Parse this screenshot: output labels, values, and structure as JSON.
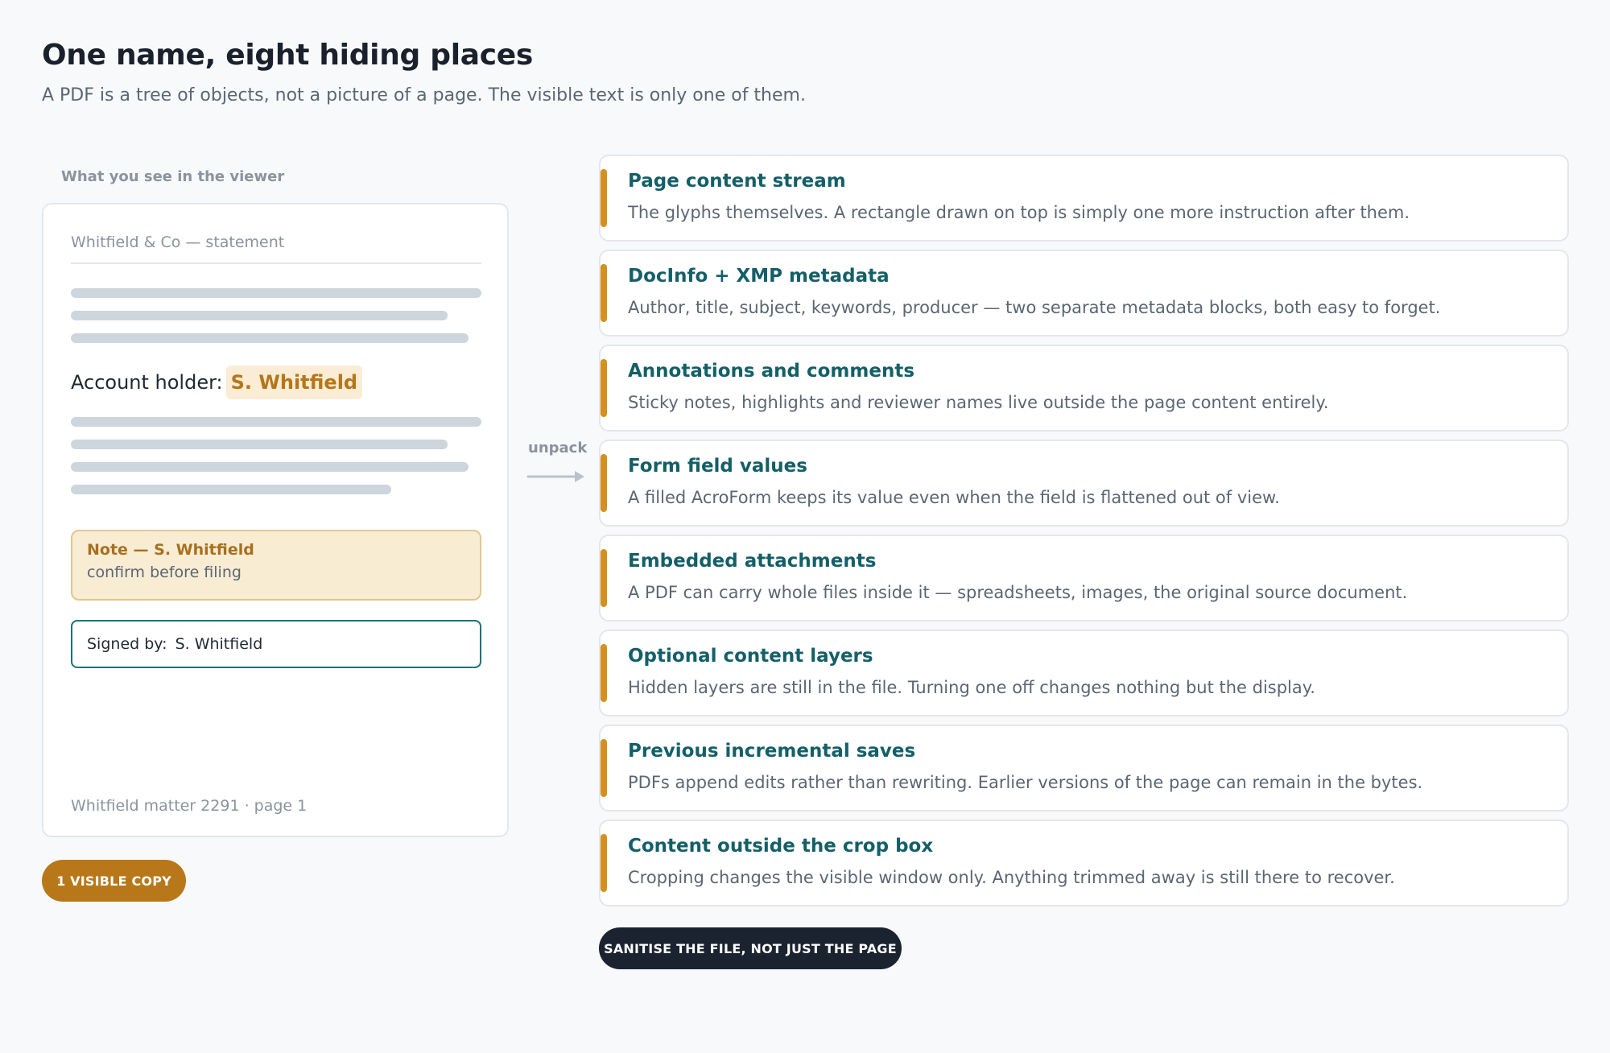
{
  "header": {
    "title": "One name, eight hiding places",
    "subtitle": "A PDF is a tree of objects, not a picture of a page. The visible text is only one of them."
  },
  "viewer": {
    "label": "What you see in the viewer",
    "doc_header": "Whitfield & Co — statement",
    "holder_label": "Account holder:",
    "holder_name": "S. Whitfield",
    "note_title": "Note — S. Whitfield",
    "note_body": "confirm before filing",
    "signed_label": "Signed by:",
    "signed_name": "S. Whitfield",
    "footer": "Whitfield matter 2291 · page 1",
    "badge": "1 VISIBLE COPY"
  },
  "connector": {
    "label": "unpack"
  },
  "places": [
    {
      "title": "Page content stream",
      "desc": "The glyphs themselves. A rectangle drawn on top is simply one more instruction after them."
    },
    {
      "title": "DocInfo + XMP metadata",
      "desc": "Author, title, subject, keywords, producer — two separate metadata blocks, both easy to forget."
    },
    {
      "title": "Annotations and comments",
      "desc": "Sticky notes, highlights and reviewer names live outside the page content entirely."
    },
    {
      "title": "Form field values",
      "desc": "A filled AcroForm keeps its value even when the field is flattened out of view."
    },
    {
      "title": "Embedded attachments",
      "desc": "A PDF can carry whole files inside it — spreadsheets, images, the original source document."
    },
    {
      "title": "Optional content layers",
      "desc": "Hidden layers are still in the file. Turning one off changes nothing but the display."
    },
    {
      "title": "Previous incremental saves",
      "desc": "PDFs append edits rather than rewriting. Earlier versions of the page can remain in the bytes."
    },
    {
      "title": "Content outside the crop box",
      "desc": "Cropping changes the visible window only. Anything trimmed away is still there to recover."
    }
  ],
  "cta": "SANITISE THE FILE, NOT JUST THE PAGE",
  "colors": {
    "accent": "#d4911f",
    "heading_teal": "#145f68",
    "badge_amber": "#b8781a",
    "cta_dark": "#1b2330"
  }
}
